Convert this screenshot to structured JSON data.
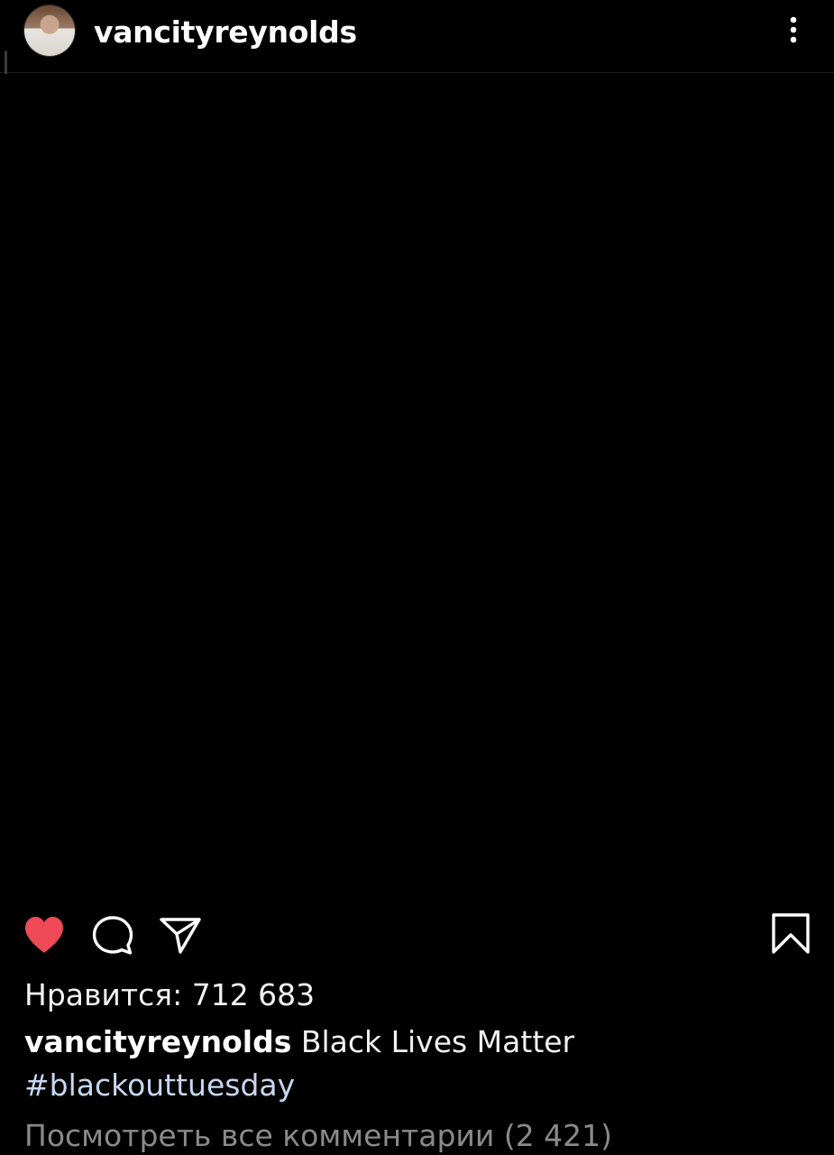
{
  "header": {
    "username": "vancityreynolds",
    "more_icon": "more-vertical-icon"
  },
  "actions": {
    "like_icon": "heart-filled-icon",
    "like_color": "#ed4956",
    "comment_icon": "comment-icon",
    "share_icon": "send-icon",
    "save_icon": "bookmark-icon"
  },
  "post": {
    "likes_text": "Нравится: 712 683",
    "caption_user": "vancityreynolds",
    "caption_text": "Black Lives Matter",
    "hashtag": "#blackouttuesday",
    "view_comments": "Посмотреть все комментарии (2 421)"
  }
}
